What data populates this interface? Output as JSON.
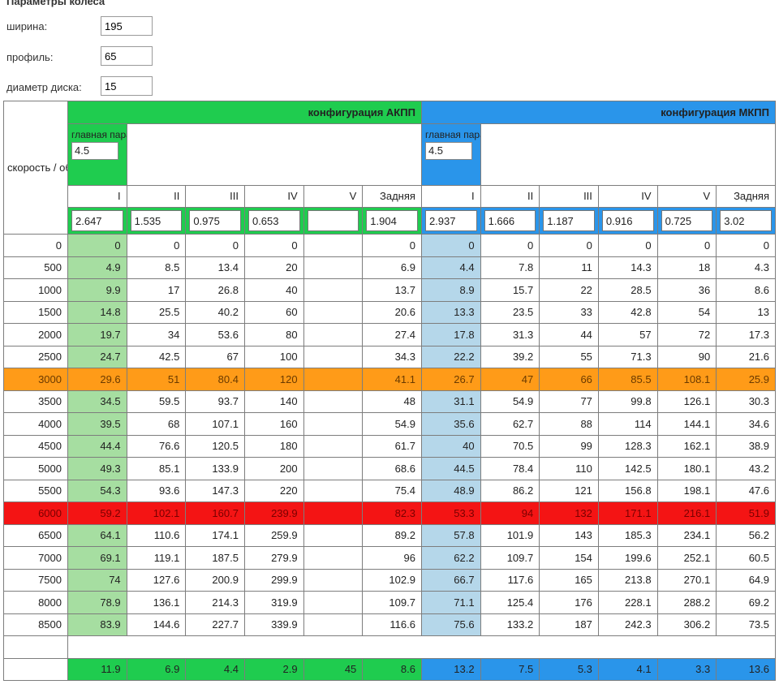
{
  "params": {
    "title": "Параметры колеса",
    "fields": [
      {
        "label": "ширина:",
        "value": "195"
      },
      {
        "label": "профиль:",
        "value": "65"
      },
      {
        "label": "диаметр диска:",
        "value": "15"
      }
    ]
  },
  "table": {
    "side_label": "скорость / обороты",
    "akpp": {
      "title": "конфигурация  АКПП",
      "main_pair_label": "главная пара",
      "main_pair_value": "4.5",
      "gears": [
        "I",
        "II",
        "III",
        "IV",
        "V",
        "Задняя"
      ],
      "ratios": [
        "2.647",
        "1.535",
        "0.975",
        "0.653",
        "",
        "1.904"
      ],
      "totals": [
        "11.9",
        "6.9",
        "4.4",
        "2.9",
        "45",
        "8.6"
      ]
    },
    "mkpp": {
      "title": "конфигурация  МКПП",
      "main_pair_label": "главная пара",
      "main_pair_value": "4.5",
      "gears": [
        "I",
        "II",
        "III",
        "IV",
        "V",
        "Задняя"
      ],
      "ratios": [
        "2.937",
        "1.666",
        "1.187",
        "0.916",
        "0.725",
        "3.02"
      ],
      "totals": [
        "13.2",
        "7.5",
        "5.3",
        "4.1",
        "3.3",
        "13.6"
      ]
    },
    "rows": [
      {
        "rpm": "0",
        "akpp": [
          "0",
          "0",
          "0",
          "0",
          "",
          "0"
        ],
        "mkpp": [
          "0",
          "0",
          "0",
          "0",
          "0",
          "0"
        ]
      },
      {
        "rpm": "500",
        "akpp": [
          "4.9",
          "8.5",
          "13.4",
          "20",
          "",
          "6.9"
        ],
        "mkpp": [
          "4.4",
          "7.8",
          "11",
          "14.3",
          "18",
          "4.3"
        ]
      },
      {
        "rpm": "1000",
        "akpp": [
          "9.9",
          "17",
          "26.8",
          "40",
          "",
          "13.7"
        ],
        "mkpp": [
          "8.9",
          "15.7",
          "22",
          "28.5",
          "36",
          "8.6"
        ]
      },
      {
        "rpm": "1500",
        "akpp": [
          "14.8",
          "25.5",
          "40.2",
          "60",
          "",
          "20.6"
        ],
        "mkpp": [
          "13.3",
          "23.5",
          "33",
          "42.8",
          "54",
          "13"
        ]
      },
      {
        "rpm": "2000",
        "akpp": [
          "19.7",
          "34",
          "53.6",
          "80",
          "",
          "27.4"
        ],
        "mkpp": [
          "17.8",
          "31.3",
          "44",
          "57",
          "72",
          "17.3"
        ]
      },
      {
        "rpm": "2500",
        "akpp": [
          "24.7",
          "42.5",
          "67",
          "100",
          "",
          "34.3"
        ],
        "mkpp": [
          "22.2",
          "39.2",
          "55",
          "71.3",
          "90",
          "21.6"
        ]
      },
      {
        "rpm": "3000",
        "akpp": [
          "29.6",
          "51",
          "80.4",
          "120",
          "",
          "41.1"
        ],
        "mkpp": [
          "26.7",
          "47",
          "66",
          "85.5",
          "108.1",
          "25.9"
        ],
        "highlight": "orange"
      },
      {
        "rpm": "3500",
        "akpp": [
          "34.5",
          "59.5",
          "93.7",
          "140",
          "",
          "48"
        ],
        "mkpp": [
          "31.1",
          "54.9",
          "77",
          "99.8",
          "126.1",
          "30.3"
        ]
      },
      {
        "rpm": "4000",
        "akpp": [
          "39.5",
          "68",
          "107.1",
          "160",
          "",
          "54.9"
        ],
        "mkpp": [
          "35.6",
          "62.7",
          "88",
          "114",
          "144.1",
          "34.6"
        ]
      },
      {
        "rpm": "4500",
        "akpp": [
          "44.4",
          "76.6",
          "120.5",
          "180",
          "",
          "61.7"
        ],
        "mkpp": [
          "40",
          "70.5",
          "99",
          "128.3",
          "162.1",
          "38.9"
        ]
      },
      {
        "rpm": "5000",
        "akpp": [
          "49.3",
          "85.1",
          "133.9",
          "200",
          "",
          "68.6"
        ],
        "mkpp": [
          "44.5",
          "78.4",
          "110",
          "142.5",
          "180.1",
          "43.2"
        ]
      },
      {
        "rpm": "5500",
        "akpp": [
          "54.3",
          "93.6",
          "147.3",
          "220",
          "",
          "75.4"
        ],
        "mkpp": [
          "48.9",
          "86.2",
          "121",
          "156.8",
          "198.1",
          "47.6"
        ]
      },
      {
        "rpm": "6000",
        "akpp": [
          "59.2",
          "102.1",
          "160.7",
          "239.9",
          "",
          "82.3"
        ],
        "mkpp": [
          "53.3",
          "94",
          "132",
          "171.1",
          "216.1",
          "51.9"
        ],
        "highlight": "red"
      },
      {
        "rpm": "6500",
        "akpp": [
          "64.1",
          "110.6",
          "174.1",
          "259.9",
          "",
          "89.2"
        ],
        "mkpp": [
          "57.8",
          "101.9",
          "143",
          "185.3",
          "234.1",
          "56.2"
        ]
      },
      {
        "rpm": "7000",
        "akpp": [
          "69.1",
          "119.1",
          "187.5",
          "279.9",
          "",
          "96"
        ],
        "mkpp": [
          "62.2",
          "109.7",
          "154",
          "199.6",
          "252.1",
          "60.5"
        ]
      },
      {
        "rpm": "7500",
        "akpp": [
          "74",
          "127.6",
          "200.9",
          "299.9",
          "",
          "102.9"
        ],
        "mkpp": [
          "66.7",
          "117.6",
          "165",
          "213.8",
          "270.1",
          "64.9"
        ]
      },
      {
        "rpm": "8000",
        "akpp": [
          "78.9",
          "136.1",
          "214.3",
          "319.9",
          "",
          "109.7"
        ],
        "mkpp": [
          "71.1",
          "125.4",
          "176",
          "228.1",
          "288.2",
          "69.2"
        ]
      },
      {
        "rpm": "8500",
        "akpp": [
          "83.9",
          "144.6",
          "227.7",
          "339.9",
          "",
          "116.6"
        ],
        "mkpp": [
          "75.6",
          "133.2",
          "187",
          "242.3",
          "306.2",
          "73.5"
        ]
      }
    ]
  }
}
